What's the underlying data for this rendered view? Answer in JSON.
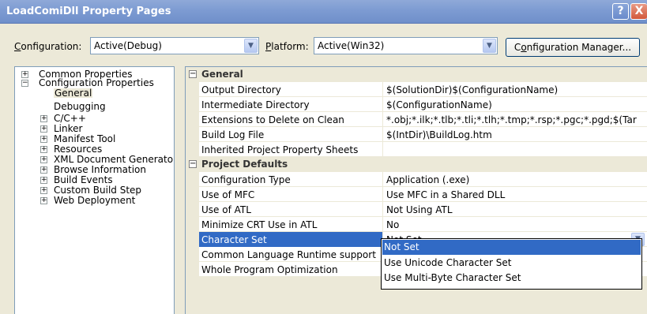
{
  "window": {
    "title": "LoadComiDll Property Pages",
    "help_glyph": "?",
    "close_glyph": "X"
  },
  "config": {
    "configuration_label": "Configuration:",
    "configuration_value": "Active(Debug)",
    "platform_label": "Platform:",
    "platform_value": "Active(Win32)",
    "manager_button": "Configuration Manager..."
  },
  "tree": {
    "items": [
      {
        "label": "Common Properties",
        "expander": "+"
      },
      {
        "label": "Configuration Properties",
        "expander": "−"
      },
      {
        "label": "General",
        "selected": true
      },
      {
        "label": "Debugging"
      },
      {
        "label": "C/C++",
        "expander": "+"
      },
      {
        "label": "Linker",
        "expander": "+"
      },
      {
        "label": "Manifest Tool",
        "expander": "+"
      },
      {
        "label": "Resources",
        "expander": "+"
      },
      {
        "label": "XML Document Generato",
        "expander": "+"
      },
      {
        "label": "Browse Information",
        "expander": "+"
      },
      {
        "label": "Build Events",
        "expander": "+"
      },
      {
        "label": "Custom Build Step",
        "expander": "+"
      },
      {
        "label": "Web Deployment",
        "expander": "+"
      }
    ]
  },
  "grid": {
    "general_category": "General",
    "general_rows": [
      {
        "name": "Output Directory",
        "value": "$(SolutionDir)$(ConfigurationName)"
      },
      {
        "name": "Intermediate Directory",
        "value": "$(ConfigurationName)"
      },
      {
        "name": "Extensions to Delete on Clean",
        "value": "*.obj;*.ilk;*.tlb;*.tli;*.tlh;*.tmp;*.rsp;*.pgc;*.pgd;$(Tar"
      },
      {
        "name": "Build Log File",
        "value": "$(IntDir)\\BuildLog.htm"
      },
      {
        "name": "Inherited Project Property Sheets",
        "value": ""
      }
    ],
    "defaults_category": "Project Defaults",
    "defaults_rows": [
      {
        "name": "Configuration Type",
        "value": "Application (.exe)"
      },
      {
        "name": "Use of MFC",
        "value": "Use MFC in a Shared DLL"
      },
      {
        "name": "Use of ATL",
        "value": "Not Using ATL"
      },
      {
        "name": "Minimize CRT Use in ATL",
        "value": "No"
      },
      {
        "name": "Character Set",
        "value": "Not Set",
        "selected": true
      },
      {
        "name": "Common Language Runtime support",
        "value": ""
      },
      {
        "name": "Whole Program Optimization",
        "value": ""
      }
    ],
    "collapse_glyph": "⊟"
  },
  "dropdown": {
    "options": [
      "Not Set",
      "Use Unicode Character Set",
      "Use Multi-Byte Character Set"
    ],
    "highlighted_index": 0
  },
  "colors": {
    "selection": "#316ac5",
    "title_bar": "#7d9bd2",
    "dialog_bg": "#ece9d8"
  }
}
